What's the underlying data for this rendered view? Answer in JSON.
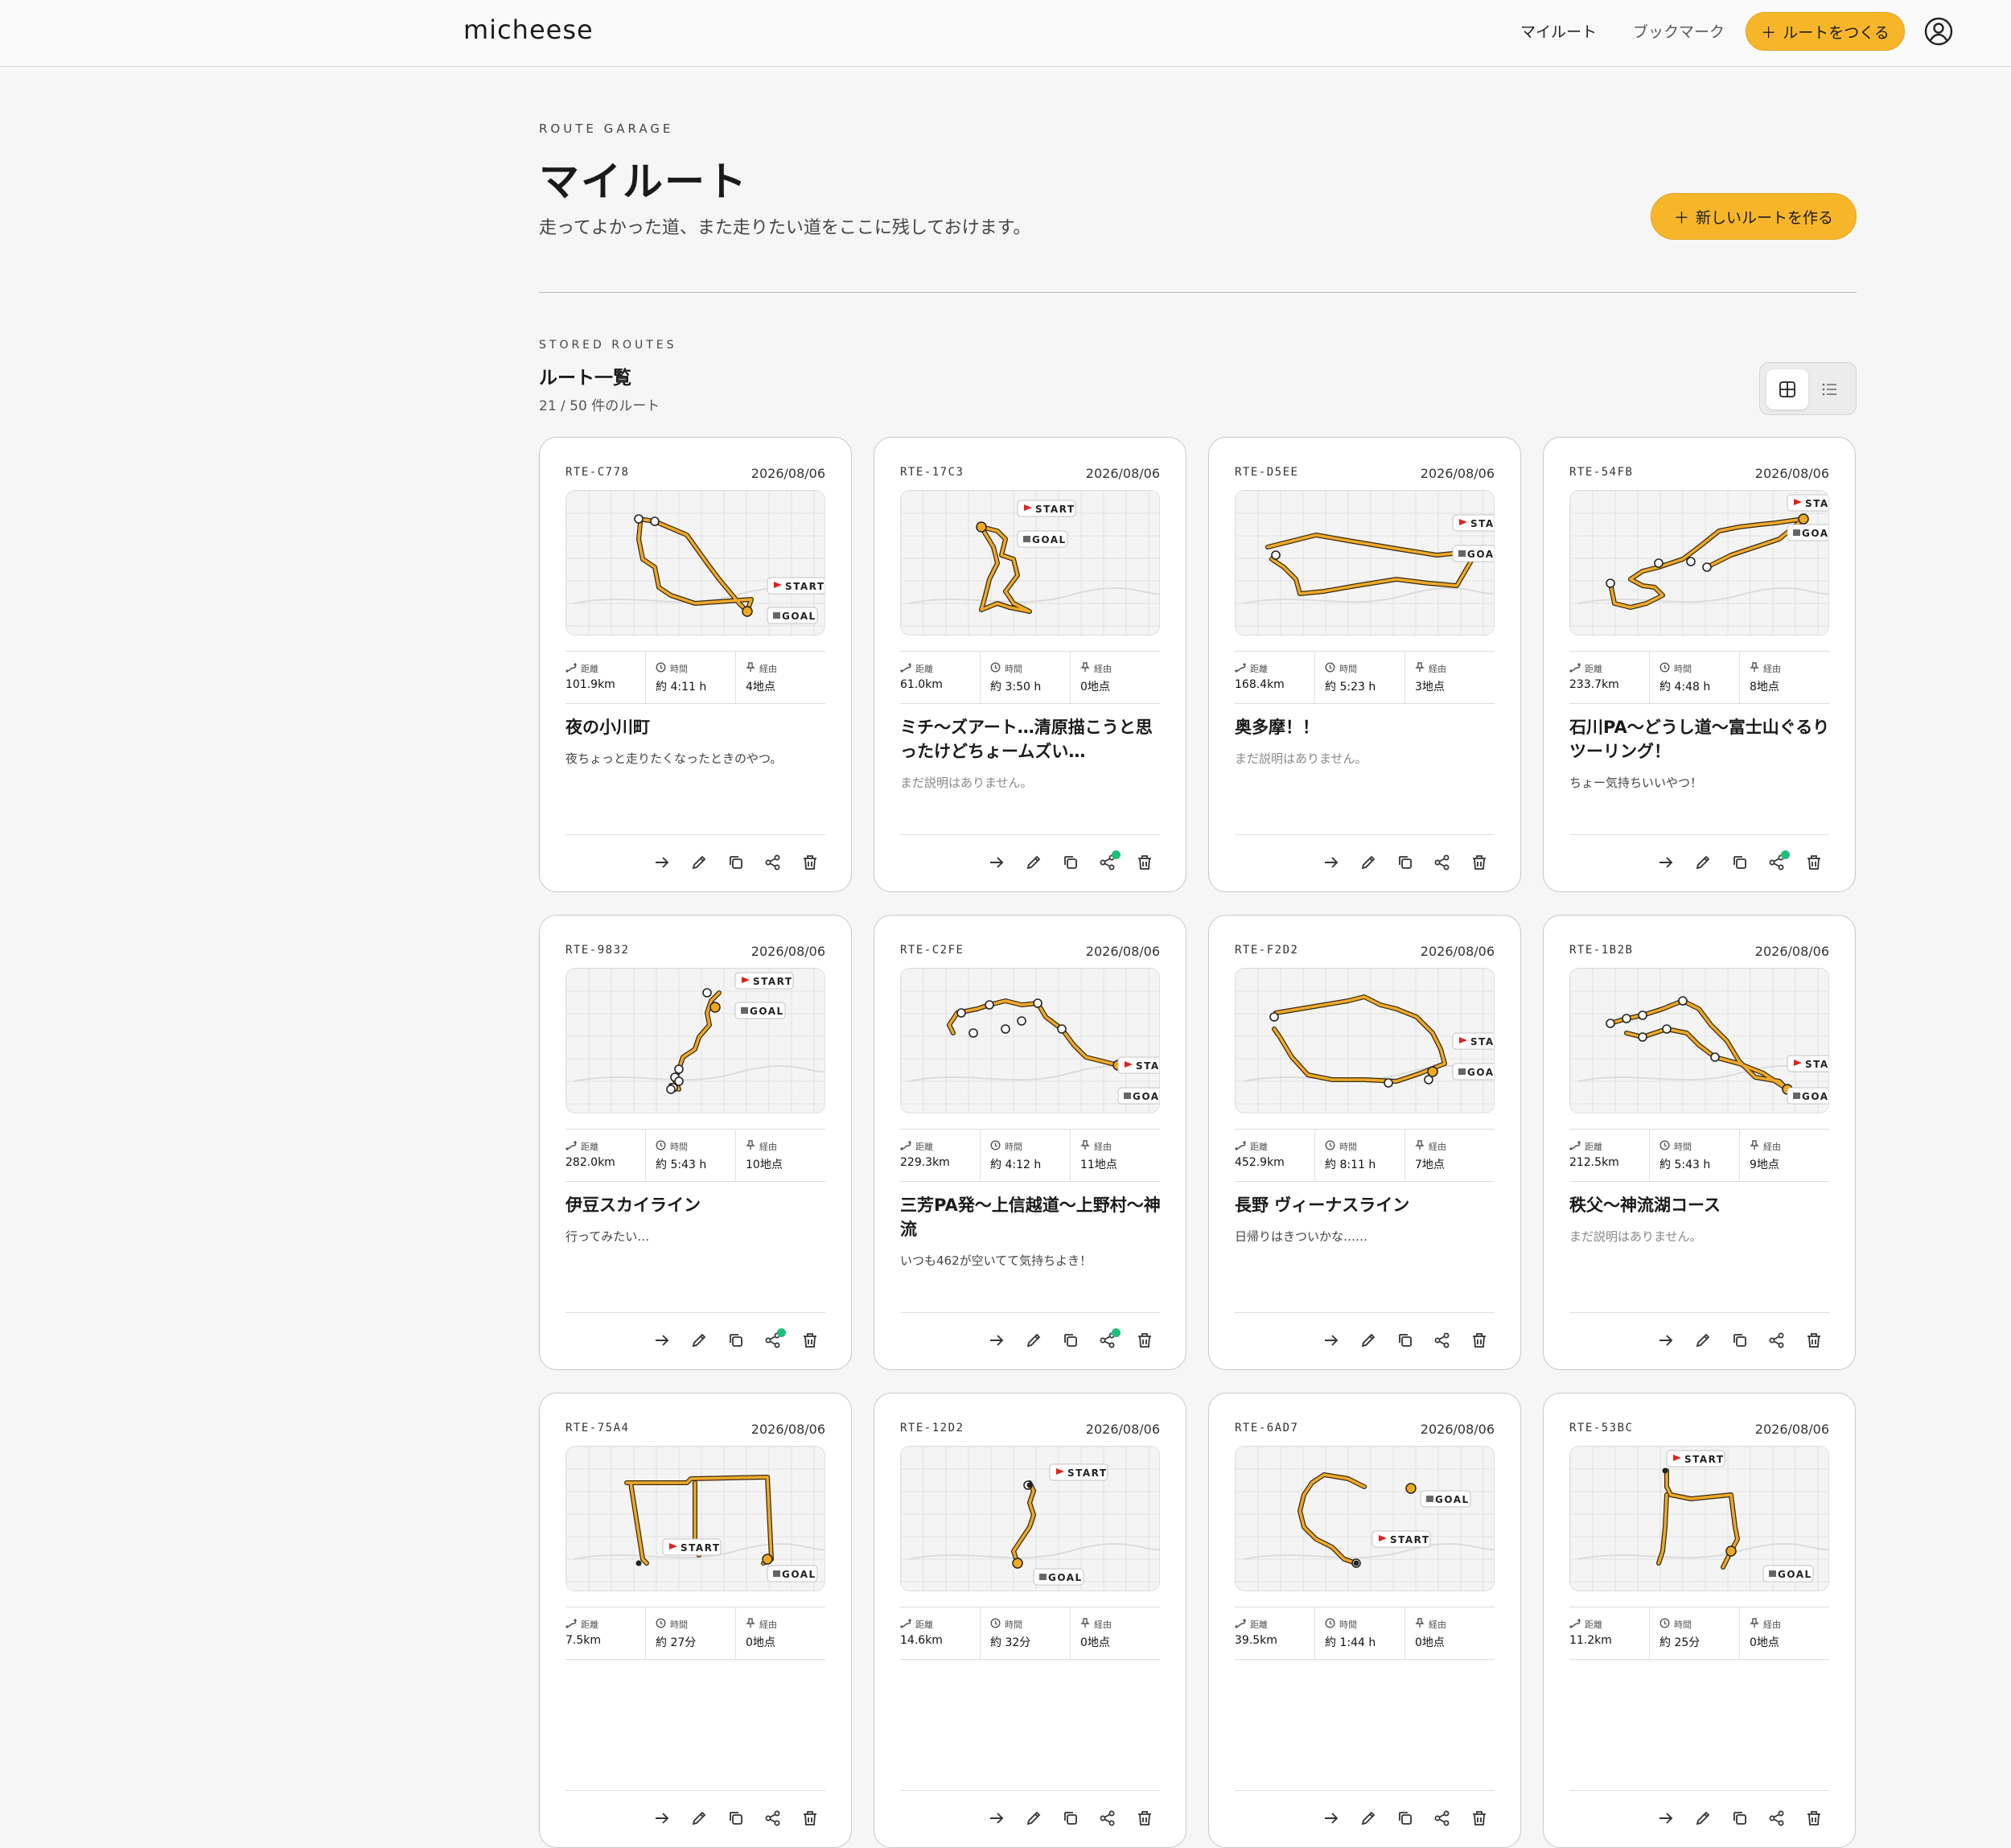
{
  "header": {
    "logo": "micheese",
    "nav_my_routes": "マイルート",
    "nav_bookmarks": "ブックマーク",
    "create_route": "ルートをつくる"
  },
  "page": {
    "eyebrow": "ROUTE GARAGE",
    "title": "マイルート",
    "subtitle": "走ってよかった道、また走りたい道をここに残しておけます。",
    "new_route_button": "新しいルートを作る"
  },
  "list": {
    "eyebrow": "STORED ROUTES",
    "title": "ルート一覧",
    "count": "21 / 50 件のルート"
  },
  "labels": {
    "distance": "距離",
    "time": "時間",
    "via": "経由",
    "start": "START",
    "goal": "GOAL"
  },
  "colors": {
    "accent": "#f7b62a",
    "route": "#e9a21e",
    "shared_dot": "#1fbf7a"
  },
  "routes": [
    {
      "id": "RTE-C778",
      "date": "2026/08/06",
      "distance": "101.9km",
      "time": "約 4:11 h",
      "via": "4地点",
      "title": "夜の小川町",
      "description": "夜ちょっと走りたくなったときのやつ。",
      "shared": false
    },
    {
      "id": "RTE-17C3",
      "date": "2026/08/06",
      "distance": "61.0km",
      "time": "約 3:50 h",
      "via": "0地点",
      "title": "ミチ〜ズアート…清原描こうと思ったけどちょームズい…",
      "description": "まだ説明はありません。",
      "shared": true
    },
    {
      "id": "RTE-D5EE",
      "date": "2026/08/06",
      "distance": "168.4km",
      "time": "約 5:23 h",
      "via": "3地点",
      "title": "奥多摩！！",
      "description": "まだ説明はありません。",
      "shared": false
    },
    {
      "id": "RTE-54FB",
      "date": "2026/08/06",
      "distance": "233.7km",
      "time": "約 4:48 h",
      "via": "8地点",
      "title": "石川PA〜どうし道〜富士山ぐるりツーリング！",
      "description": "ちょー気持ちいいやつ！",
      "shared": true
    },
    {
      "id": "RTE-9832",
      "date": "2026/08/06",
      "distance": "282.0km",
      "time": "約 5:43 h",
      "via": "10地点",
      "title": "伊豆スカイライン",
      "description": "行ってみたい…",
      "shared": true
    },
    {
      "id": "RTE-C2FE",
      "date": "2026/08/06",
      "distance": "229.3km",
      "time": "約 4:12 h",
      "via": "11地点",
      "title": "三芳PA発〜上信越道〜上野村〜神流",
      "description": "いつも462が空いてて気持ちよき！",
      "shared": true
    },
    {
      "id": "RTE-F2D2",
      "date": "2026/08/06",
      "distance": "452.9km",
      "time": "約 8:11 h",
      "via": "7地点",
      "title": "長野 ヴィーナスライン",
      "description": "日帰りはきついかな……",
      "shared": false
    },
    {
      "id": "RTE-1B2B",
      "date": "2026/08/06",
      "distance": "212.5km",
      "time": "約 5:43 h",
      "via": "9地点",
      "title": "秩父〜神流湖コース",
      "description": "まだ説明はありません。",
      "shared": false
    },
    {
      "id": "RTE-75A4",
      "date": "2026/08/06",
      "distance": "7.5km",
      "time": "約 27分",
      "via": "0地点",
      "title": "",
      "description": "",
      "shared": false
    },
    {
      "id": "RTE-12D2",
      "date": "2026/08/06",
      "distance": "14.6km",
      "time": "約 32分",
      "via": "0地点",
      "title": "",
      "description": "",
      "shared": false
    },
    {
      "id": "RTE-6AD7",
      "date": "2026/08/06",
      "distance": "39.5km",
      "time": "約 1:44 h",
      "via": "0地点",
      "title": "",
      "description": "",
      "shared": false
    },
    {
      "id": "RTE-53BC",
      "date": "2026/08/06",
      "distance": "11.2km",
      "time": "約 25分",
      "via": "0地点",
      "title": "",
      "description": "",
      "shared": false
    }
  ]
}
